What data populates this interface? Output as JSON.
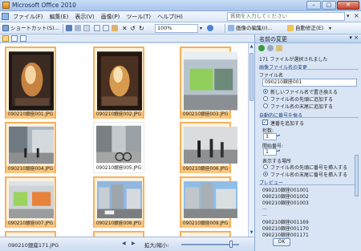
{
  "window": {
    "title": "Microsoft Office 2010"
  },
  "menubar": {
    "items": [
      "ファイル(F)",
      "編集(E)",
      "表示(V)",
      "画像(P)",
      "ツール(T)",
      "ヘルプ(H)"
    ],
    "help_placeholder": "質問を入力してください"
  },
  "toolbar": {
    "shortcut": "ショートカット(S)...",
    "zoom": "100%",
    "edit_image": "画像の編集(I)...",
    "auto_fix": "自動修正(E)"
  },
  "thumbnails": [
    {
      "caption": "090210銀座001.JPG",
      "selected": true,
      "scene": "store-window"
    },
    {
      "caption": "090210銀座002.JPG",
      "selected": true,
      "scene": "store-window"
    },
    {
      "caption": "090210銀座003.JPG",
      "selected": true,
      "scene": "storefront"
    },
    {
      "caption": "090210銀座004.JPG",
      "selected": true,
      "scene": "street"
    },
    {
      "caption": "090210銀座005.JPG",
      "selected": false,
      "scene": "street"
    },
    {
      "caption": "090210銀座006.JPG",
      "selected": true,
      "scene": "street"
    },
    {
      "caption": "090210銀座007.JPG",
      "selected": true,
      "scene": "storefront"
    },
    {
      "caption": "090210銀座008.JPG",
      "selected": true,
      "scene": "city"
    },
    {
      "caption": "090210銀座009.JPG",
      "selected": true,
      "scene": "city"
    }
  ],
  "statusbar": {
    "current_file": "090210銀座171.JPG",
    "zoom_label": "拡大/縮小:",
    "zoom_level": 0.85
  },
  "pane": {
    "title": "名前の変更",
    "selected_info": "171 ファイルが選択されました",
    "section_rename": "画像ファイル名の変更",
    "label_filename": "ファイル名",
    "filename_value": "090210銀座001",
    "opt_replace": "新しいファイル名で置き換える",
    "opt_prefix": "ファイル名の先頭に追加する",
    "opt_suffix": "ファイル名の末尾に追加する",
    "section_auto": "自動的に番号を振る",
    "add_sequence": "連番を追加する",
    "label_digits": "桁数:",
    "digits_value": "3",
    "label_start": "開始番号:",
    "start_value": "1",
    "label_position": "表示する場所",
    "pos_start": "ファイル名の先頭に番号を挿入する",
    "pos_end": "ファイル名の末尾に番号を挿入する",
    "section_preview": "プレビュー",
    "preview": [
      "090210銀座001001",
      "090210銀座001002",
      "090210銀座001003",
      "...",
      "...",
      "090210銀座001169",
      "090210銀座001170",
      "090210銀座001171"
    ],
    "ok": "OK"
  },
  "colors": {
    "selection": "#f7b05b",
    "chrome": "#d9e5f5"
  }
}
